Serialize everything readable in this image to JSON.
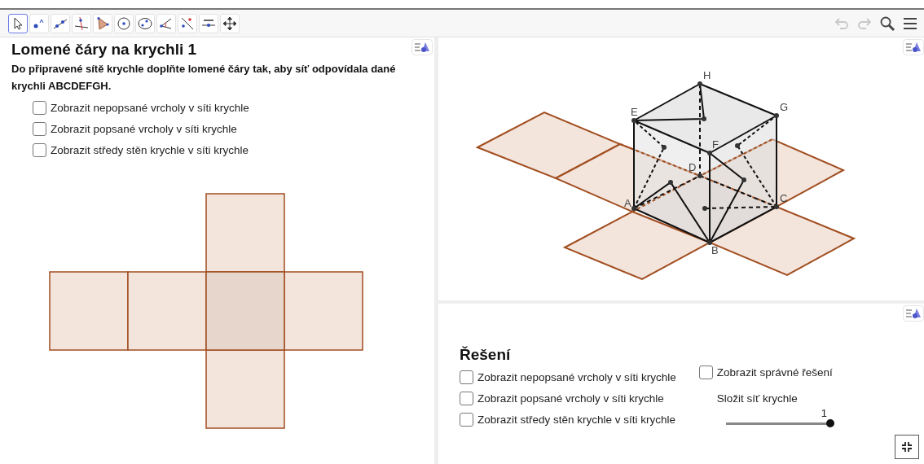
{
  "toolbar": {
    "tools": [
      {
        "kind": "pointer",
        "selected": true
      },
      {
        "kind": "point",
        "selected": false
      },
      {
        "kind": "line",
        "selected": false
      },
      {
        "kind": "perpendicular",
        "selected": false
      },
      {
        "kind": "polygon",
        "selected": false
      },
      {
        "kind": "circle",
        "selected": false
      },
      {
        "kind": "conic",
        "selected": false
      },
      {
        "kind": "angle",
        "selected": false
      },
      {
        "kind": "reflect",
        "selected": false
      },
      {
        "kind": "slider",
        "selected": false
      },
      {
        "kind": "move",
        "selected": false
      }
    ],
    "actions": [
      {
        "kind": "undo",
        "disabled": true
      },
      {
        "kind": "redo",
        "disabled": true
      },
      {
        "kind": "search",
        "disabled": false
      },
      {
        "kind": "menu",
        "disabled": false
      }
    ]
  },
  "left_panel": {
    "title": "Lomené čáry na krychli 1",
    "instructions": "Do připravené sítě krychle doplňte lomené čáry tak, aby síť odpovídala dané krychli ABCDEFGH.",
    "checkboxes": [
      {
        "label": "Zobrazit nepopsané vrcholy v síti krychle",
        "checked": false
      },
      {
        "label": "Zobrazit popsané vrcholy v síti krychle",
        "checked": false
      },
      {
        "label": "Zobrazit středy stěn krychle v síti krychle",
        "checked": false
      }
    ]
  },
  "view_3d": {
    "vertices": [
      {
        "label": "A"
      },
      {
        "label": "B"
      },
      {
        "label": "C"
      },
      {
        "label": "D"
      },
      {
        "label": "E"
      },
      {
        "label": "F"
      },
      {
        "label": "G"
      },
      {
        "label": "H"
      }
    ]
  },
  "solution_panel": {
    "title": "Řešení",
    "checkboxes": [
      {
        "label": "Zobrazit nepopsané vrcholy v síti krychle",
        "checked": false
      },
      {
        "label": "Zobrazit popsané vrcholy v síti krychle",
        "checked": false
      },
      {
        "label": "Zobrazit středy stěn krychle v síti krychle",
        "checked": false
      }
    ],
    "correct_solution": {
      "label": "Zobrazit správné řešení",
      "checked": false
    },
    "slider": {
      "label": "Složit síť krychle",
      "reading": "1",
      "level": 1
    }
  }
}
